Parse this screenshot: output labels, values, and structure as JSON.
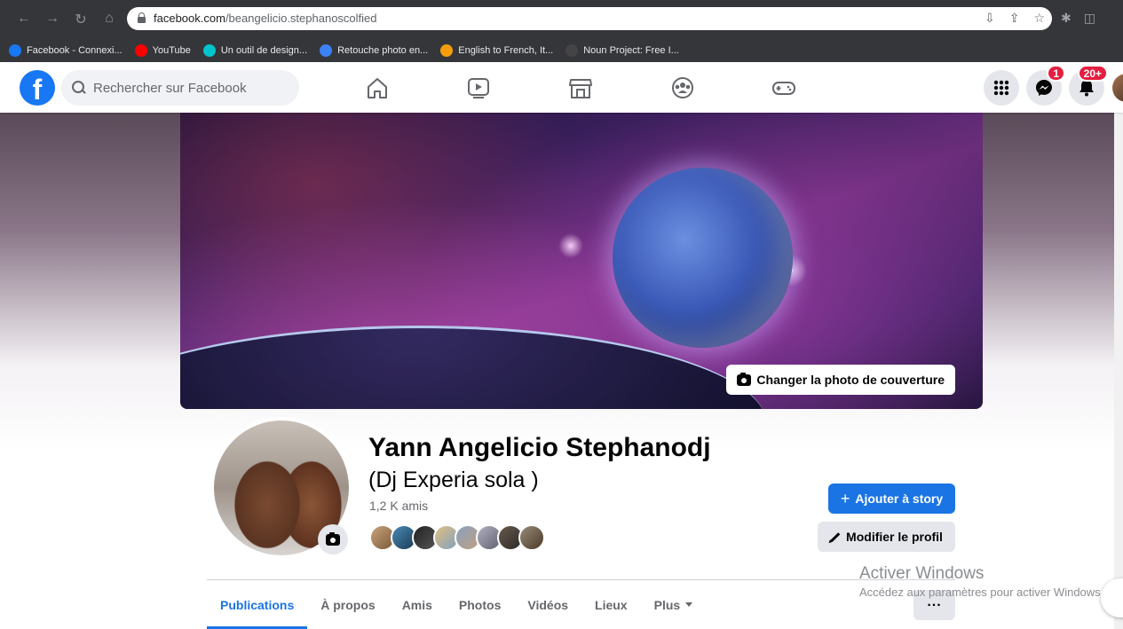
{
  "browser": {
    "url_host": "facebook.com",
    "url_path": "/beangelicio.stephanoscolfied",
    "bookmarks": [
      {
        "label": "Facebook - Connexi...",
        "icon": "facebook-icon",
        "color": "#1877f2"
      },
      {
        "label": "YouTube",
        "icon": "youtube-icon",
        "color": "#ff0000"
      },
      {
        "label": "Un outil de design...",
        "icon": "canva-icon",
        "color": "#00c4cc"
      },
      {
        "label": "Retouche photo en...",
        "icon": "photo-edit-icon",
        "color": "#3b82f6"
      },
      {
        "label": "English to French, It...",
        "icon": "reverso-icon",
        "color": "#f59e0b"
      },
      {
        "label": "Noun Project: Free I...",
        "icon": "noun-project-icon",
        "color": "#444444"
      }
    ]
  },
  "fb_nav": {
    "logo": "f",
    "search_placeholder": "Rechercher sur Facebook",
    "messenger_badge": "1",
    "notifications_badge": "20+"
  },
  "cover": {
    "change_button": "Changer la photo de couverture"
  },
  "profile": {
    "name": "Yann Angelicio Stephanodj",
    "nickname": "(Dj Experia sola )",
    "friends_count": "1,2 K amis",
    "add_story": "Ajouter à story",
    "edit_profile": "Modifier le profil"
  },
  "tabs": [
    {
      "label": "Publications",
      "active": true
    },
    {
      "label": "À propos"
    },
    {
      "label": "Amis"
    },
    {
      "label": "Photos"
    },
    {
      "label": "Vidéos"
    },
    {
      "label": "Lieux"
    },
    {
      "label": "Plus"
    }
  ],
  "windows_watermark": {
    "title": "Activer Windows",
    "subtitle": "Accédez aux paramètres pour activer Windows."
  },
  "colors": {
    "fb_blue": "#1877f2",
    "button_blue": "#1b74e4",
    "badge_red": "#e41e3f"
  }
}
